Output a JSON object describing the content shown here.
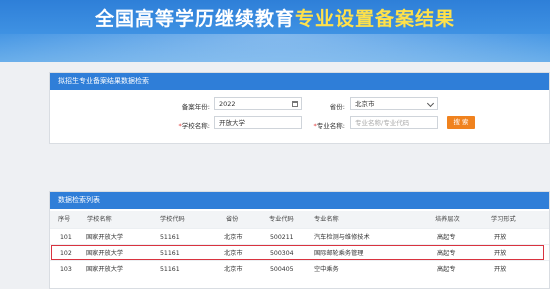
{
  "header": {
    "title_white": "全国高等学历继续教育",
    "title_yellow": "专业设置备案结果"
  },
  "search": {
    "panel_title": "拟招生专业备案结果数据检索",
    "year_label": "备案年份:",
    "year_value": "2022",
    "province_label": "省份:",
    "province_value": "北京市",
    "school_label": "学校名称:",
    "school_value": "开放大学",
    "major_label": "专业名称:",
    "major_placeholder": "专业名称/专业代码",
    "search_button": "搜 索"
  },
  "results": {
    "panel_title": "数据检索列表",
    "columns": [
      "序号",
      "学校名称",
      "学校代码",
      "省份",
      "专业代码",
      "专业名称",
      "培养层次",
      "学习形式"
    ],
    "rows": [
      [
        "101",
        "国家开放大学",
        "51161",
        "北京市",
        "500211",
        "汽车检测与维修技术",
        "高起专",
        "开放"
      ],
      [
        "102",
        "国家开放大学",
        "51161",
        "北京市",
        "500304",
        "国际邮轮乘务管理",
        "高起专",
        "开放"
      ],
      [
        "103",
        "国家开放大学",
        "51161",
        "北京市",
        "500405",
        "空中乘务",
        "高起专",
        "开放"
      ]
    ]
  },
  "colors": {
    "header_blue": "#2f7ed8",
    "title_yellow": "#ffe14a",
    "button_orange": "#f0821e",
    "highlight_red": "#d9333f"
  }
}
